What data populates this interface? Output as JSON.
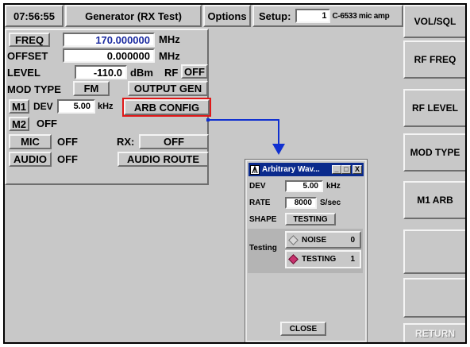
{
  "header": {
    "time": "07:56:55",
    "title": "Generator (RX Test)",
    "options_label": "Options",
    "setup_label": "Setup:",
    "setup_number": "1",
    "setup_name": "C-6533 mic amp"
  },
  "main": {
    "freq": {
      "label": "FREQ",
      "value": "170.000000",
      "unit": "MHz"
    },
    "offset": {
      "label": "OFFSET",
      "value": "0.000000",
      "unit": "MHz"
    },
    "level": {
      "label": "LEVEL",
      "value": "-110.0",
      "unit": "dBm",
      "rf_label": "RF",
      "rf_state": "OFF"
    },
    "mod_type": {
      "label": "MOD TYPE",
      "value": "FM",
      "output_gen_label": "OUTPUT GEN"
    },
    "m1": {
      "label": "M1",
      "dev_label": "DEV",
      "dev_value": "5.00",
      "dev_unit": "kHz",
      "arb_config_label": "ARB CONFIG"
    },
    "m2": {
      "label": "M2",
      "state": "OFF"
    },
    "mic": {
      "label": "MIC",
      "state": "OFF",
      "rx_label": "RX:",
      "rx_state": "OFF"
    },
    "audio": {
      "label": "AUDIO",
      "state": "OFF",
      "route_label": "AUDIO ROUTE"
    }
  },
  "sidebar": {
    "buttons": [
      {
        "label": "VOL/SQL"
      },
      {
        "label": "RF FREQ"
      },
      {
        "label": "RF LEVEL"
      },
      {
        "label": "MOD TYPE"
      },
      {
        "label": "M1 ARB"
      },
      {
        "label": ""
      },
      {
        "label": ""
      },
      {
        "label": "RETURN"
      }
    ]
  },
  "dialog": {
    "title": "Arbitrary Wav...",
    "minimize_glyph": "_",
    "maximize_glyph": "□",
    "close_glyph": "X",
    "dev": {
      "label": "DEV",
      "value": "5.00",
      "unit": "kHz"
    },
    "rate": {
      "label": "RATE",
      "value": "8000",
      "unit": "S/sec"
    },
    "shape": {
      "label": "SHAPE",
      "value": "TESTING"
    },
    "testing": {
      "label": "Testing",
      "options": [
        {
          "label": "NOISE",
          "count": "0",
          "selected": false
        },
        {
          "label": "TESTING",
          "count": "1",
          "selected": true
        }
      ]
    },
    "close_label": "CLOSE"
  },
  "colors": {
    "background": "#c8c8c8",
    "freq_value_text": "#1a2aa0",
    "highlight_border": "#e01818",
    "arrow": "#1030d0",
    "dialog_title_bg": "#0a2a8c",
    "radio_selected": "#c8326e"
  },
  "icons": {
    "dialog_app_icon": "antenna-icon",
    "arrow": "down-arrow-icon"
  }
}
